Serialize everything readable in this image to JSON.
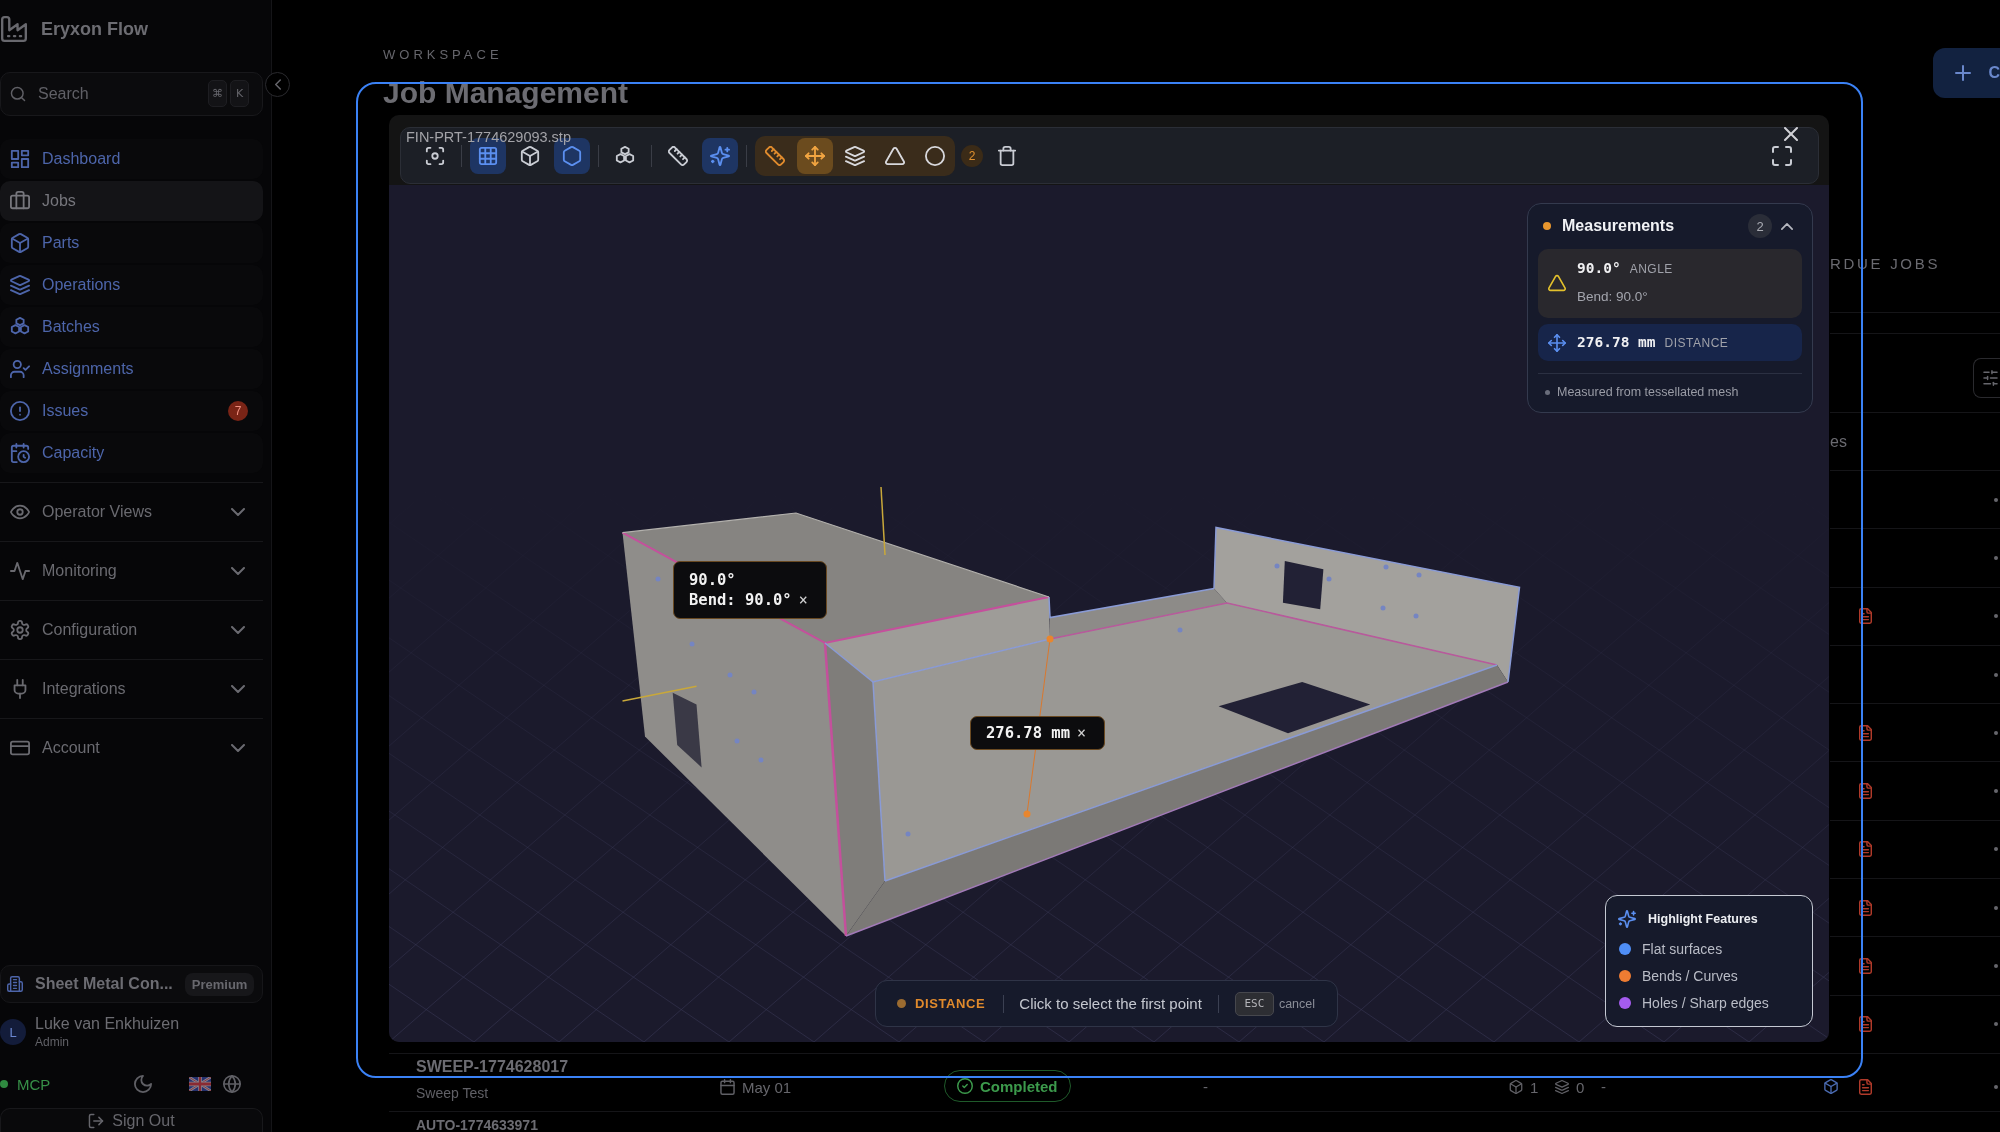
{
  "sidebar": {
    "brand": "Eryxon Flow",
    "search": {
      "placeholder": "Search",
      "shortcut": [
        "⌘",
        "K"
      ]
    },
    "nav": [
      {
        "label": "Dashboard",
        "selected": false
      },
      {
        "label": "Jobs",
        "selected": true
      },
      {
        "label": "Parts",
        "selected": false
      },
      {
        "label": "Operations",
        "selected": false
      },
      {
        "label": "Batches",
        "selected": false
      },
      {
        "label": "Assignments",
        "selected": false
      },
      {
        "label": "Issues",
        "selected": false,
        "badge": "7"
      },
      {
        "label": "Capacity",
        "selected": false
      }
    ],
    "groups": [
      {
        "label": "Operator Views",
        "expanded": false
      },
      {
        "label": "Monitoring",
        "expanded": false
      },
      {
        "label": "Configuration",
        "expanded": false
      },
      {
        "label": "Integrations",
        "expanded": false
      },
      {
        "label": "Account",
        "expanded": false
      }
    ],
    "organization": {
      "name": "Sheet Metal Con...",
      "plan": "Premium"
    },
    "user": {
      "initial": "L",
      "name": "Luke van Enkhuizen",
      "role": "Admin"
    },
    "mcp": {
      "label": "MCP",
      "on": true
    },
    "sign_out": "Sign Out"
  },
  "page": {
    "eyebrow": "WORKSPACE",
    "title": "Job Management",
    "primary_action": "C",
    "section_title": "RDUE JOBS",
    "column_header": "es"
  },
  "table": {
    "rows": [
      {
        "kind": "plain"
      },
      {
        "kind": "plain"
      },
      {
        "kind": "files"
      },
      {
        "kind": "plain"
      },
      {
        "kind": "files"
      },
      {
        "kind": "files"
      },
      {
        "kind": "files"
      },
      {
        "kind": "files"
      },
      {
        "kind": "files"
      },
      {
        "kind": "files"
      }
    ],
    "jobs": [
      {
        "id": "SWEEP-1774628017",
        "name": "Sweep Test",
        "date": "May 01",
        "status": "Completed",
        "column_4": "-",
        "parts": "1",
        "operations": "0",
        "column_7": "-"
      },
      {
        "id": "AUTO-1774633971"
      }
    ]
  },
  "viewer": {
    "file_name": "FIN-PRT-1774629093.stp",
    "toolbar": {
      "view_buttons": [
        {
          "selected": false
        },
        {
          "selected": true
        },
        {
          "selected": false
        },
        {
          "selected": true
        },
        {
          "selected": false
        },
        {
          "selected": false
        },
        {
          "selected": true
        }
      ],
      "measure_mode": {
        "on": true
      },
      "measure_tools": [
        {
          "selected": true
        },
        {
          "selected": false
        },
        {
          "selected": false
        },
        {
          "selected": false
        }
      ],
      "measure_count": "2"
    },
    "tags": [
      {
        "kind": "angle",
        "lines": [
          "90.0°",
          "Bend: 90.0°"
        ],
        "remove": "×"
      },
      {
        "kind": "distance",
        "lines": [
          "276.78 mm"
        ],
        "remove": "×"
      }
    ],
    "measurements": {
      "title": "Measurements",
      "count": "2",
      "expanded": true,
      "items": [
        {
          "kind": "angle",
          "value": "90.0°",
          "type": "ANGLE",
          "detail": "Bend: 90.0°"
        },
        {
          "kind": "distance",
          "value": "276.78 mm",
          "type": "DISTANCE"
        }
      ],
      "note": "Measured from tessellated mesh"
    },
    "status": {
      "mode": "DISTANCE",
      "hint": "Click to select the first point",
      "key": "ESC",
      "key_action": "cancel"
    },
    "legend": {
      "title": "Highlight Features",
      "items": [
        {
          "label": "Flat surfaces",
          "color": "#4f8ef6"
        },
        {
          "label": "Bends / Curves",
          "color": "#ee7c32"
        },
        {
          "label": "Holes / Sharp edges",
          "color": "#a55cf0"
        }
      ]
    }
  }
}
